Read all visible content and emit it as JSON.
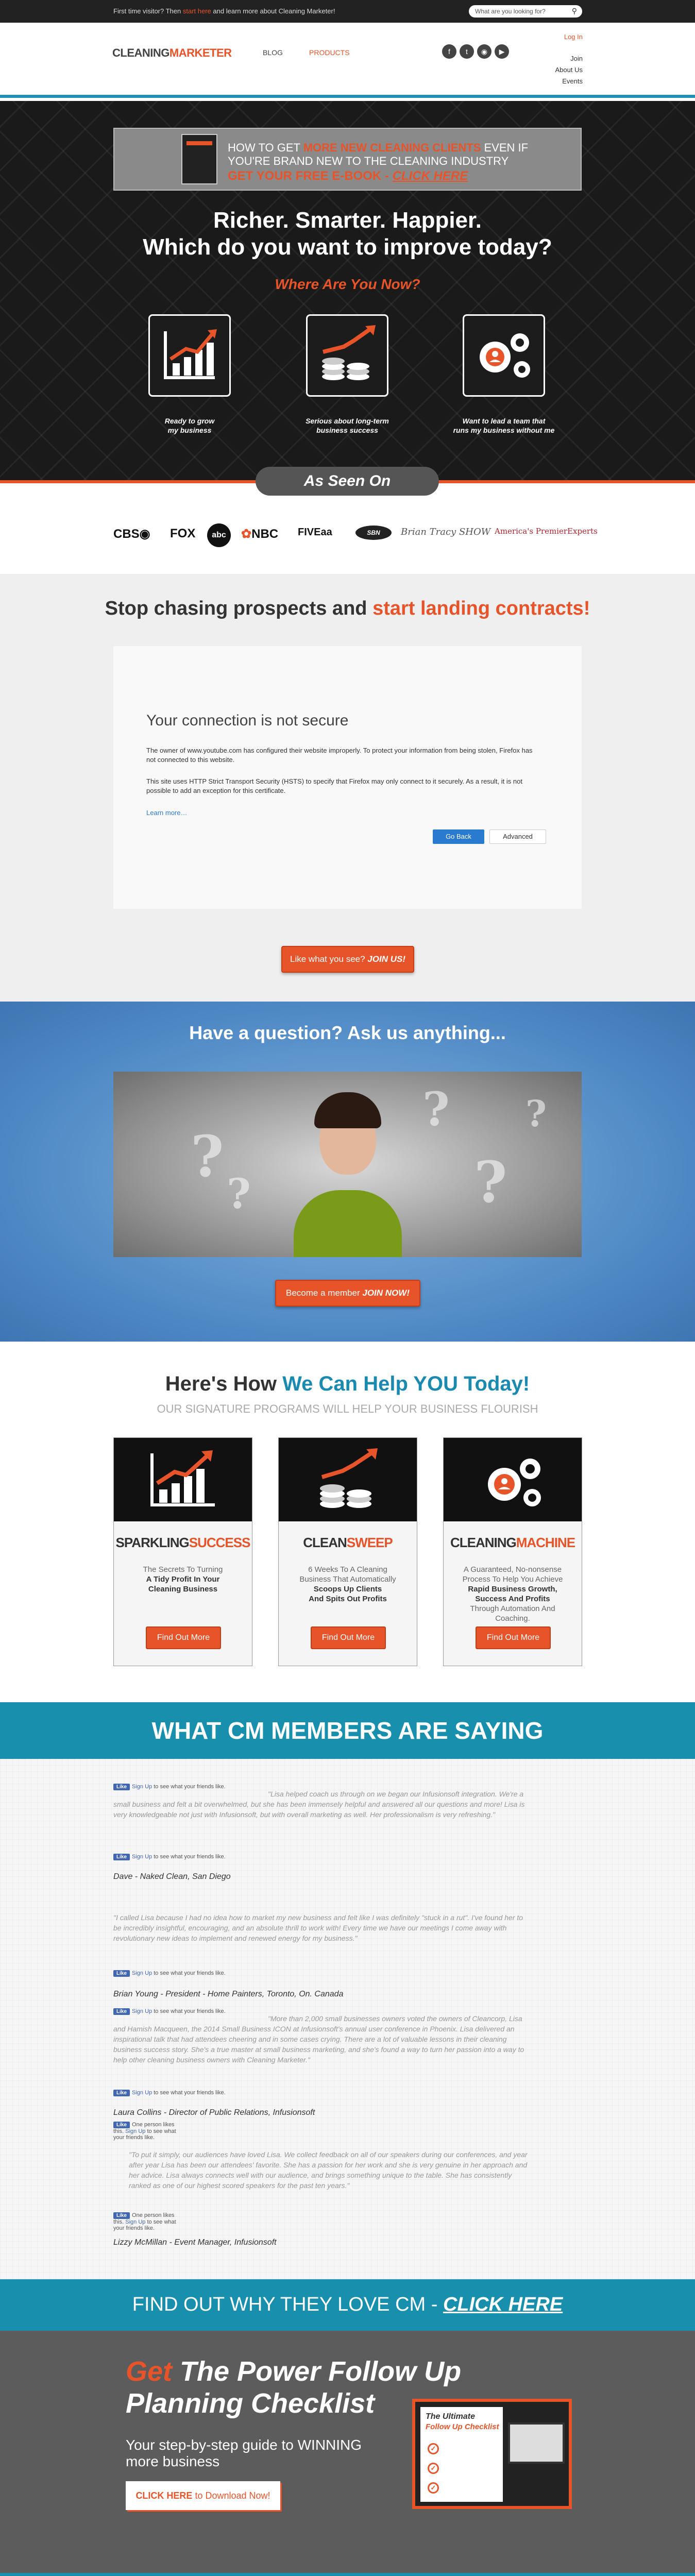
{
  "topbar": {
    "message_prefix": "First time visitor? Then",
    "message_link": "start here",
    "message_suffix": "and learn more about Cleaning Marketer!",
    "search_placeholder": "What are you looking for?"
  },
  "header": {
    "logo_part1": "CLEANING",
    "logo_part2": "MARKETER",
    "nav": {
      "blog": "BLOG",
      "products": "PRODUCTS"
    },
    "social_icons": [
      "facebook-icon",
      "twitter-icon",
      "instagram-icon",
      "youtube-icon"
    ],
    "right_links": {
      "login": "Log In",
      "join": "Join",
      "about": "About Us",
      "events": "Events"
    },
    "accent_color": "#e8542a",
    "brand_blue": "#1a8ab0"
  },
  "hero": {
    "ebook": {
      "line1_a": "HOW TO GET",
      "line1_b": "MORE NEW CLEANING CLIENTS",
      "line1_c": "EVEN IF",
      "line2": "YOU'RE BRAND NEW TO THE CLEANING INDUSTRY",
      "line3_a": "GET YOUR FREE E-BOOK -",
      "line3_b": "CLICK HERE"
    },
    "headline1": "Richer. Smarter. Happier.",
    "headline2": "Which do you want to improve today?",
    "subheadline": "Where Are You Now?",
    "options": [
      {
        "icon": "growth-chart-icon",
        "cap1": "Ready to grow",
        "cap2": "my business"
      },
      {
        "icon": "money-growth-icon",
        "cap1": "Serious about long-term",
        "cap2": "business success"
      },
      {
        "icon": "team-gears-icon",
        "cap1": "Want to lead a team that",
        "cap2": "runs my business without me"
      }
    ]
  },
  "as_seen_on": {
    "label": "As Seen On",
    "logos": [
      "CBS",
      "FOX",
      "abc",
      "NBC",
      "FIVEaa",
      "SBN",
      "Brian Tracy SHOW",
      "America's PremierExperts"
    ]
  },
  "stop": {
    "title_a": "Stop chasing prospects and",
    "title_b": "start landing contracts!",
    "video": {
      "heading": "Your connection is not secure",
      "p1": "The owner of www.youtube.com has configured their website improperly. To protect your information from being stolen, Firefox has not connected to this website.",
      "p2": "This site uses HTTP Strict Transport Security (HSTS) to specify that Firefox may only connect to it securely. As a result, it is not possible to add an exception for this certificate.",
      "learn_more": "Learn more…",
      "go_back": "Go Back",
      "advanced": "Advanced"
    },
    "cta_a": "Like what you see?",
    "cta_b": "JOIN US!"
  },
  "question": {
    "title": "Have a question? Ask us anything...",
    "cta_a": "Become a member",
    "cta_b": "JOIN NOW!"
  },
  "help": {
    "title_a": "Here's How",
    "title_b": "We Can Help YOU Today!",
    "subtitle": "OUR SIGNATURE PROGRAMS WILL HELP YOUR BUSINESS FLOURISH",
    "cards": [
      {
        "t1": "SPARKLING",
        "t2": "SUCCESS",
        "d1": "The Secrets To Turning",
        "d2": "A Tidy Profit In Your",
        "d3": "Cleaning Business",
        "d4": "",
        "btn": "Find Out More"
      },
      {
        "t1": "CLEAN",
        "t2": "SWEEP",
        "d1": "6 Weeks To A Cleaning",
        "d2": "Business That Automatically",
        "d3": "Scoops Up Clients",
        "d4": "And Spits Out Profits",
        "btn": "Find Out More"
      },
      {
        "t1": "CLEANING",
        "t2": "MACHINE",
        "d1": "A Guaranteed, No-nonsense",
        "d2": "Process To Help You Achieve",
        "d3": "Rapid Business Growth, Success And Profits",
        "d4": "Through Automation And Coaching.",
        "btn": "Find Out More"
      }
    ]
  },
  "members": {
    "title": "WHAT CM MEMBERS ARE SAYING",
    "like_label": "Like",
    "like_text_a": "Sign Up",
    "like_text_b": "to see what your friends like.",
    "like_text_one": "One person likes this.",
    "testimonials": [
      {
        "quote": "\"Lisa helped coach us through on we began our Infusionsoft integration. We're a small business and felt a bit overwhelmed, but she has been immensely helpful and answered all our questions and more! Lisa is very knowledgeable not just with Infusionsoft, but with overall marketing as well. Her professionalism is very refreshing.\"",
        "author": "Dave - Naked Clean, San Diego"
      },
      {
        "quote": "\"I called Lisa because I had no idea how to market my new business and felt like I was definitely \"stuck in a rut\". I've found her to be incredibly insightful, encouraging, and an absolute thrill to work with! Every time we have our meetings I come away with revolutionary new ideas to implement and renewed energy for my business.\"",
        "author": "Brian Young - President - Home Painters, Toronto, On. Canada"
      },
      {
        "quote": "\"More than 2,000 small businesses owners voted the owners of Cleancorp, Lisa and Hamish Macqueen, the 2014 Small Business ICON at Infusionsoft's annual user conference in Phoenix. Lisa delivered an inspirational talk that had attendees cheering and in some cases crying. There are a lot of valuable lessons in their cleaning business success story. She's a true master at small business marketing, and she's found a way to turn her passion into a way to help other cleaning business owners with Cleaning Marketer.\"",
        "author": "Laura Collins - Director of Public Relations, Infusionsoft"
      },
      {
        "quote": "\"To put it simply, our audiences have loved Lisa. We collect feedback on all of our speakers during our conferences, and year after year Lisa has been our attendees' favorite. She has a passion for her work and she is very genuine in her approach and her advice. Lisa always connects well with our audience, and brings something unique to the table. She has consistently ranked as one of our highest scored speakers for the past ten years.\"",
        "author": "Lizzy McMillan - Event Manager, Infusionsoft"
      }
    ]
  },
  "findout": {
    "text_a": "FIND OUT WHY THEY LOVE CM -",
    "text_b": "CLICK HERE"
  },
  "followup": {
    "h_a": "Get",
    "h_b": "The Power Follow Up",
    "h_c": "Planning Checklist",
    "sub1": "Your step-by-step guide to WINNING",
    "sub2": "more business",
    "btn_a": "CLICK HERE",
    "btn_b": "to Download Now!",
    "doc_t1": "The Ultimate",
    "doc_t2": "Follow Up Checklist"
  }
}
